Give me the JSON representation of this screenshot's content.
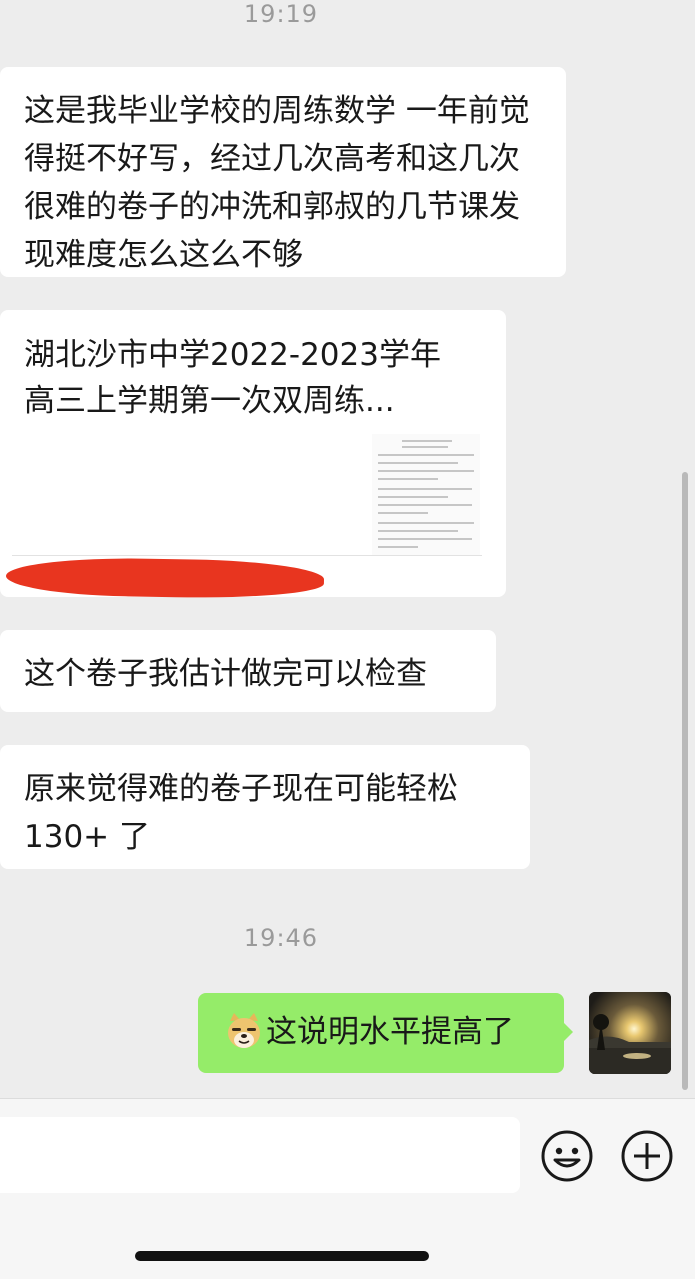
{
  "chat": {
    "timestamp_1": "19:19",
    "messages": [
      {
        "text": "这是我毕业学校的周练数学 一年前觉得挺不好写，经过几次高考和这几次很难的卷子的冲洗和郭叔的几节课发现难度怎么这么不够"
      },
      {
        "text": "这个卷子我估计做完可以检查"
      },
      {
        "text": "原来觉得难的卷子现在可能轻松130+ 了"
      }
    ],
    "file_card": {
      "title": "湖北沙市中学2022-2023学年高三上学期第一次双周练..."
    },
    "timestamp_2": "19:46",
    "outgoing": {
      "emoji": "doge-emoji",
      "text": "这说明水平提高了"
    },
    "avatar": "sunset-avatar"
  },
  "input_bar": {
    "emoji_icon": "smiley-icon",
    "more_icon": "plus-circle-icon"
  },
  "colors": {
    "background": "#ededed",
    "incoming_bubble": "#ffffff",
    "outgoing_bubble": "#95ec69",
    "redaction": "#e8351f"
  }
}
